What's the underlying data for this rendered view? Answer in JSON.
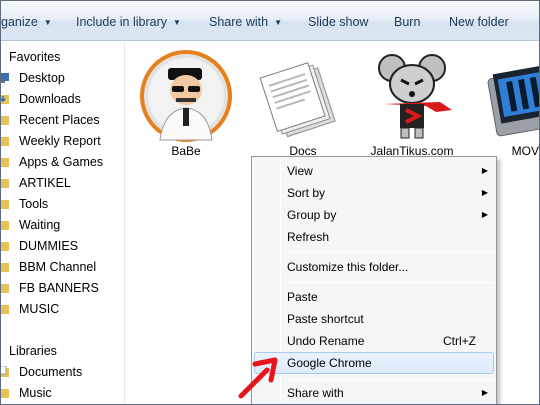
{
  "toolbar": {
    "organize": "ganize",
    "include_in_library": "Include in library",
    "share_with": "Share with",
    "slide_show": "Slide show",
    "burn": "Burn",
    "new_folder": "New folder"
  },
  "nav": {
    "favorites_header": "Favorites",
    "favorites": [
      "Desktop",
      "Downloads",
      "Recent Places",
      "Weekly Report",
      "Apps & Games",
      "ARTIKEL",
      "Tools",
      "Waiting",
      "DUMMIES",
      "BBM Channel",
      "FB BANNERS",
      "MUSIC"
    ],
    "libraries_header": "Libraries",
    "libraries": [
      "Documents",
      "Music"
    ]
  },
  "files": [
    "BaBe",
    "Docs",
    "JalanTikus.com",
    "MOVIE"
  ],
  "context_menu": {
    "view": "View",
    "sort_by": "Sort by",
    "group_by": "Group by",
    "refresh": "Refresh",
    "customize": "Customize this folder...",
    "paste": "Paste",
    "paste_shortcut": "Paste shortcut",
    "undo_rename": "Undo Rename",
    "undo_shortcut": "Ctrl+Z",
    "google_chrome": "Google Chrome",
    "share_with": "Share with"
  },
  "colors": {
    "annotation_arrow": "#e8141c",
    "folder": "#e8c25a",
    "highlight_border": "#a8cbee"
  }
}
